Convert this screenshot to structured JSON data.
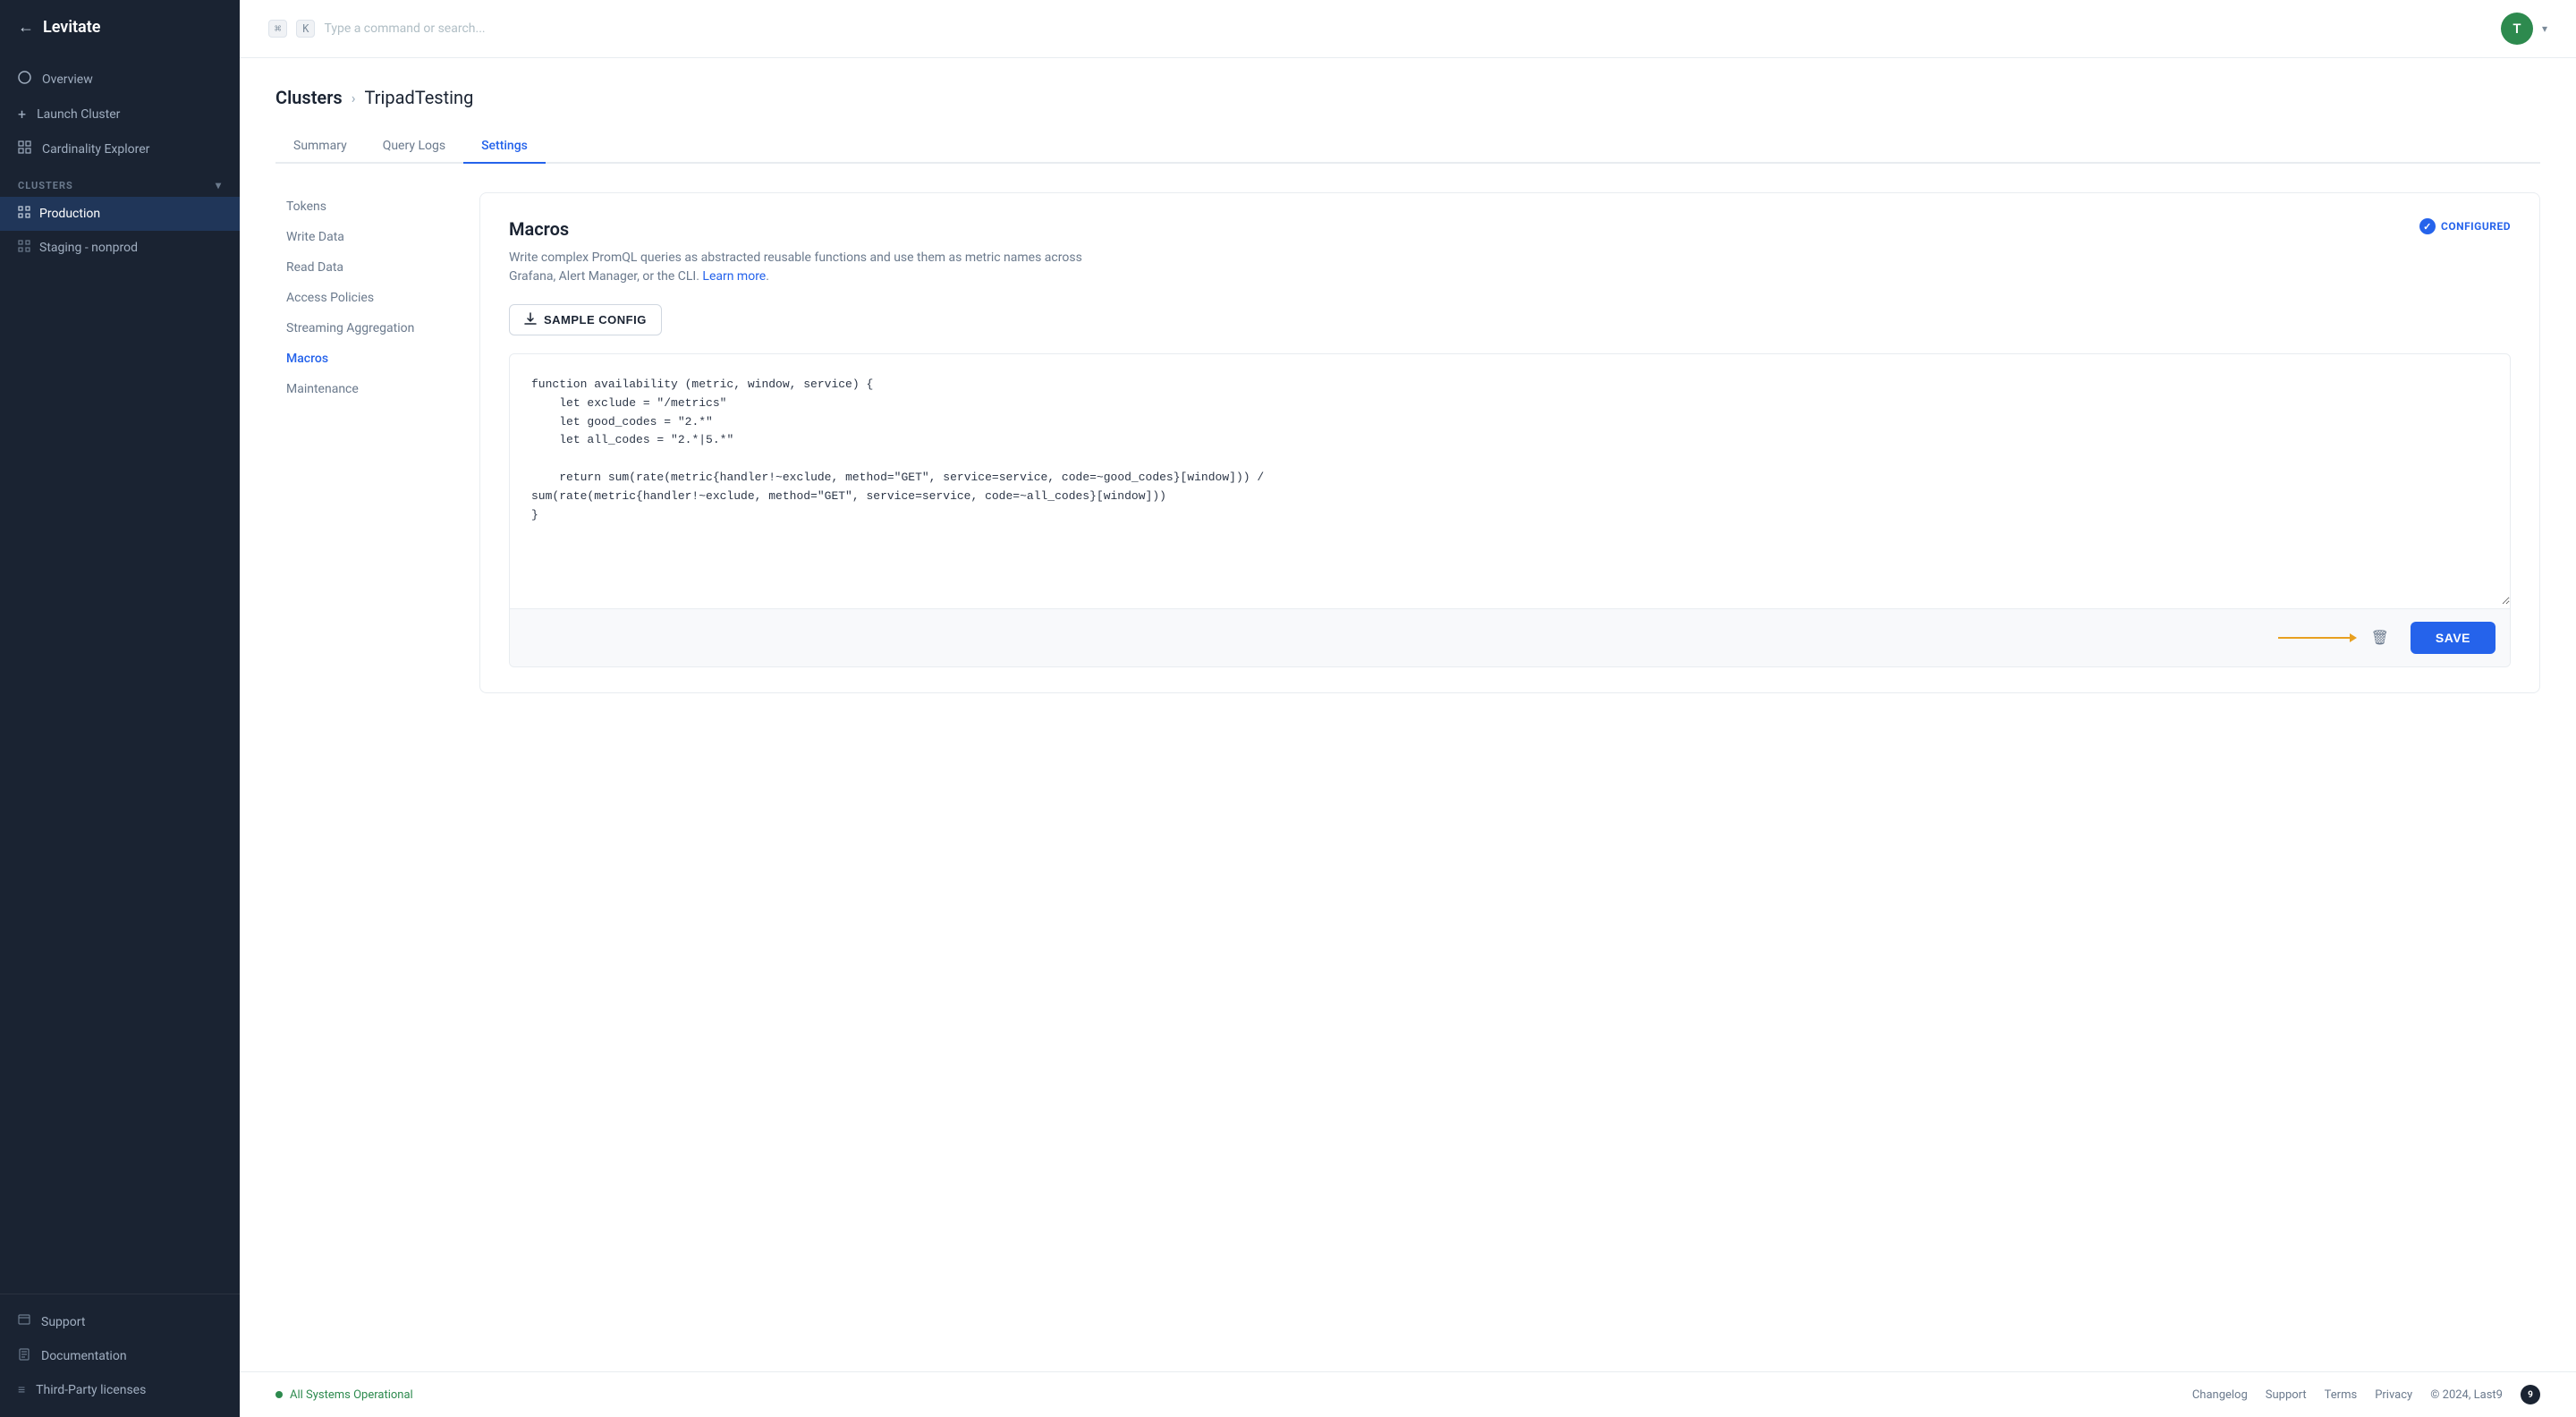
{
  "app": {
    "title": "Levitate"
  },
  "sidebar": {
    "back_icon": "←",
    "nav_items": [
      {
        "id": "overview",
        "label": "Overview",
        "icon": "○"
      },
      {
        "id": "launch-cluster",
        "label": "Launch Cluster",
        "icon": "+"
      },
      {
        "id": "cardinality-explorer",
        "label": "Cardinality Explorer",
        "icon": "□"
      }
    ],
    "section_label": "CLUSTERS",
    "clusters": [
      {
        "id": "production",
        "label": "Production",
        "active": true
      },
      {
        "id": "staging-nonprod",
        "label": "Staging - nonprod",
        "active": false
      }
    ],
    "bottom_items": [
      {
        "id": "support",
        "label": "Support",
        "icon": "☐"
      },
      {
        "id": "documentation",
        "label": "Documentation",
        "icon": "☐"
      },
      {
        "id": "third-party-licenses",
        "label": "Third-Party licenses",
        "icon": "≡"
      }
    ]
  },
  "topbar": {
    "shortcut_modifier": "⌘",
    "shortcut_key": "K",
    "search_placeholder": "Type a command or search...",
    "avatar_initial": "T",
    "chevron": "▾"
  },
  "breadcrumb": {
    "clusters_label": "Clusters",
    "separator": "›",
    "current": "TripadTesting"
  },
  "tabs": [
    {
      "id": "summary",
      "label": "Summary",
      "active": false
    },
    {
      "id": "query-logs",
      "label": "Query Logs",
      "active": false
    },
    {
      "id": "settings",
      "label": "Settings",
      "active": true
    }
  ],
  "settings_nav": [
    {
      "id": "tokens",
      "label": "Tokens",
      "active": false
    },
    {
      "id": "write-data",
      "label": "Write Data",
      "active": false
    },
    {
      "id": "read-data",
      "label": "Read Data",
      "active": false
    },
    {
      "id": "access-policies",
      "label": "Access Policies",
      "active": false
    },
    {
      "id": "streaming-aggregation",
      "label": "Streaming Aggregation",
      "active": false
    },
    {
      "id": "macros",
      "label": "Macros",
      "active": true
    },
    {
      "id": "maintenance",
      "label": "Maintenance",
      "active": false
    }
  ],
  "macros": {
    "title": "Macros",
    "description": "Write complex PromQL queries as abstracted reusable functions and use them as metric names across Grafana, Alert Manager, or the CLI.",
    "learn_more_text": "Learn more",
    "configured_label": "CONFIGURED",
    "sample_config_label": "SAMPLE CONFIG",
    "code_content": "function availability (metric, window, service) {\n    let exclude = \"/metrics\"\n    let good_codes = \"2.*\"\n    let all_codes = \"2.*|5.*\"\n\n    return sum(rate(metric{handler!~exclude, method=\"GET\", service=service, code=~good_codes}[window])) /\nsum(rate(metric{handler!~exclude, method=\"GET\", service=service, code=~all_codes}[window]))\n}",
    "save_label": "SAVE",
    "delete_icon": "🗑"
  },
  "footer": {
    "status_text": "All Systems Operational",
    "changelog_label": "Changelog",
    "support_label": "Support",
    "terms_label": "Terms",
    "privacy_label": "Privacy",
    "copyright": "© 2024, Last9"
  }
}
